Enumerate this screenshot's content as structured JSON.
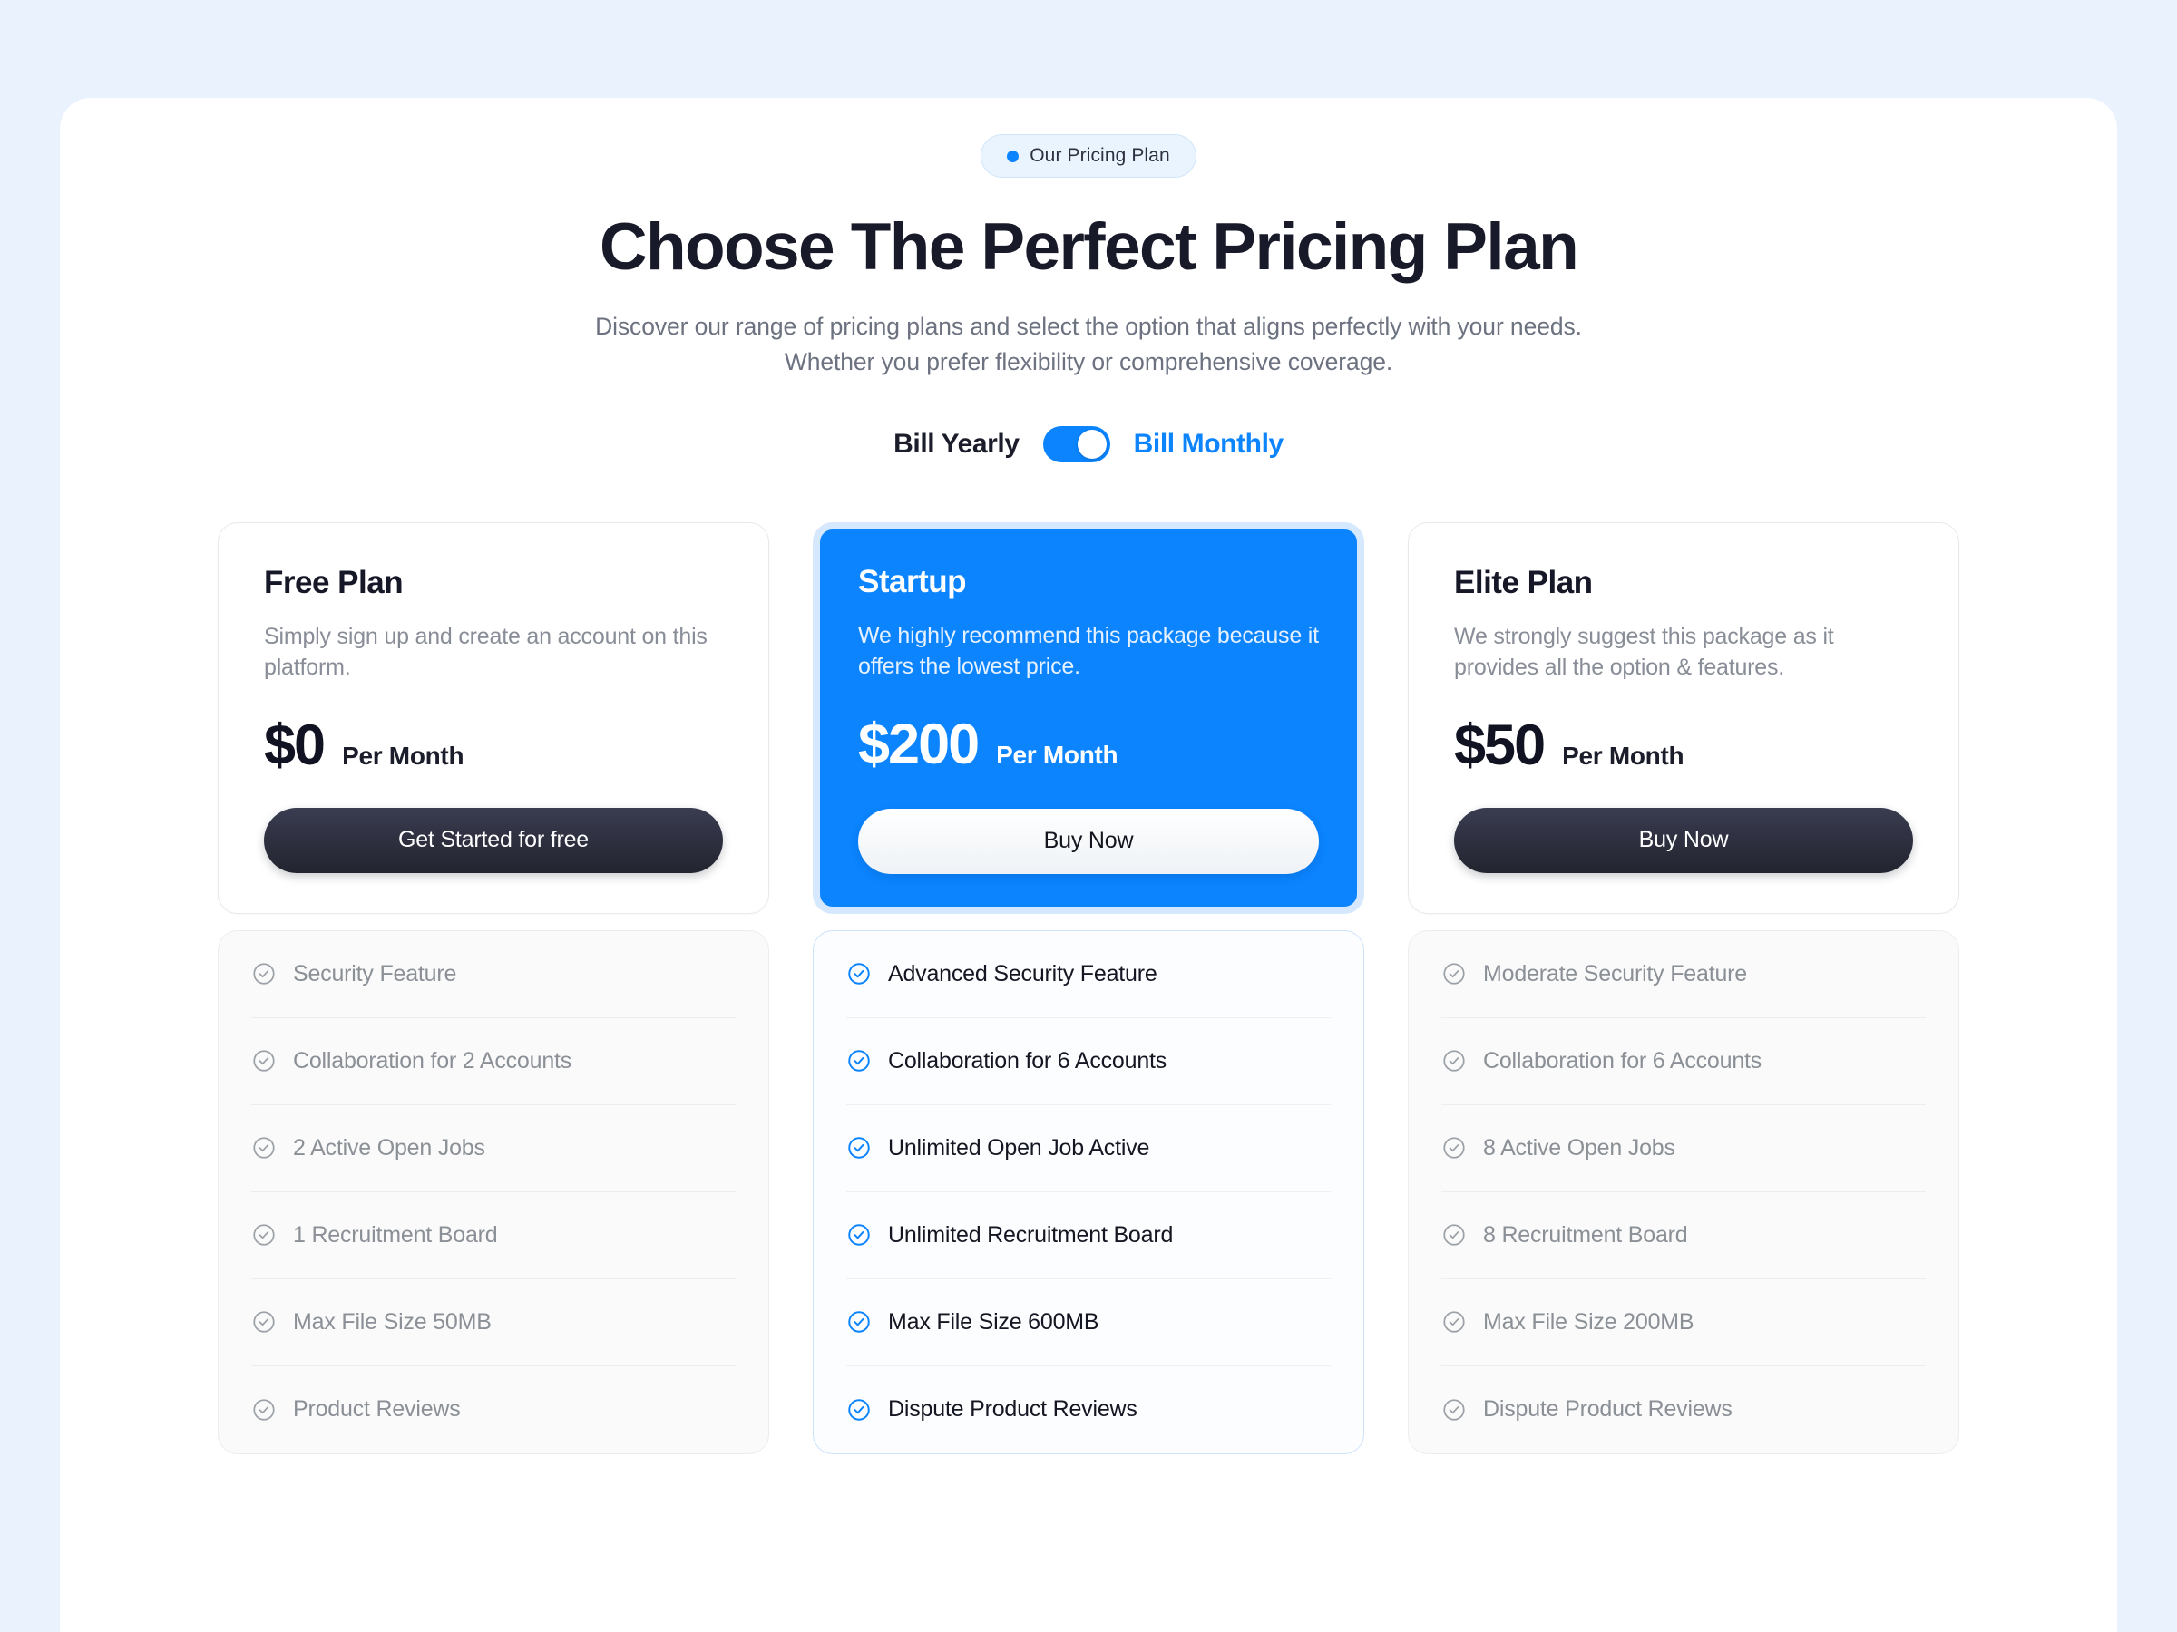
{
  "header": {
    "badge_label": "Our Pricing Plan",
    "badge_dot_icon": "dot-icon",
    "headline": "Choose The Perfect Pricing Plan",
    "subline": "Discover our range of pricing plans and select the option that aligns perfectly with your needs. Whether you prefer flexibility or comprehensive coverage."
  },
  "billing": {
    "yearly_label": "Bill Yearly",
    "monthly_label": "Bill Monthly",
    "toggle_state": "monthly",
    "accent_color": "#0b84fe"
  },
  "plans": [
    {
      "name": "Free Plan",
      "description": "Simply sign up and create an account on this platform.",
      "price": "$0",
      "period": "Per Month",
      "cta": "Get Started for free",
      "featured": false,
      "features": [
        "Security Feature",
        "Collaboration for 2 Accounts",
        "2 Active Open Jobs",
        "1 Recruitment Board",
        "Max File Size 50MB",
        "Product Reviews"
      ]
    },
    {
      "name": "Startup",
      "description": "We highly recommend this package because it offers the lowest price.",
      "price": "$200",
      "period": "Per Month",
      "cta": "Buy Now",
      "featured": true,
      "features": [
        "Advanced Security Feature",
        "Collaboration for 6 Accounts",
        "Unlimited Open Job Active",
        "Unlimited Recruitment Board",
        "Max File Size 600MB",
        "Dispute Product Reviews"
      ]
    },
    {
      "name": "Elite Plan",
      "description": "We strongly suggest this package as it provides all the option & features.",
      "price": "$50",
      "period": "Per Month",
      "cta": "Buy Now",
      "featured": false,
      "features": [
        "Moderate Security Feature",
        "Collaboration for 6 Accounts",
        "8 Active Open Jobs",
        "8 Recruitment Board",
        "Max File Size 200MB",
        "Dispute Product Reviews"
      ]
    }
  ],
  "icons": {
    "feature_check": "circle-check-icon"
  },
  "colors": {
    "page_background": "#e9f2fd",
    "panel_background": "#ffffff",
    "accent_blue": "#0b84fe",
    "dark_button": "#22242f",
    "muted_text": "#8b9097"
  }
}
